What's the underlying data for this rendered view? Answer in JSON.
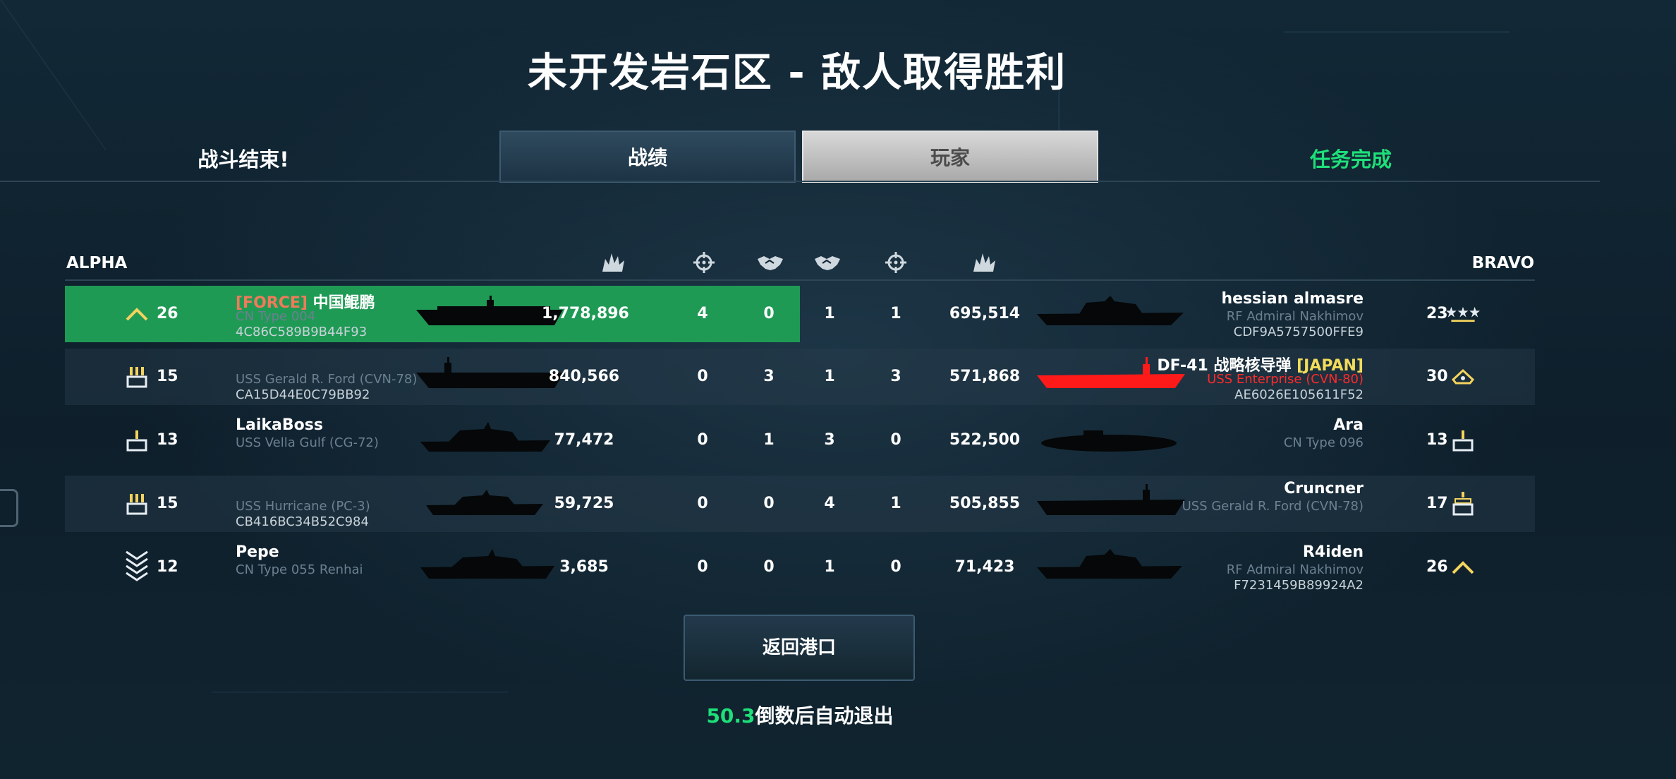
{
  "title": "未开发岩石区 - 敌人取得胜利",
  "header": {
    "battle_over": "战斗结束!",
    "tabs": [
      {
        "label": "战绩"
      },
      {
        "label": "玩家",
        "selected": true
      }
    ],
    "mission_status": "任务完成"
  },
  "teams": {
    "left": "ALPHA",
    "right": "BRAVO"
  },
  "column_icons": [
    "explosion-icon",
    "crosshair-icon",
    "handshake-icon",
    "handshake-icon",
    "crosshair-icon",
    "explosion-icon"
  ],
  "rows": [
    {
      "left": {
        "rank_icon": "chevron-icon",
        "level": "26",
        "tag": "[FORCE]",
        "name": "中国鲲鹏",
        "ship": "CN Type 004",
        "id": "4C86C589B9B44F93",
        "score": "1,778,896",
        "kills": "4",
        "assists": "0",
        "highlight": true
      },
      "right": {
        "rank_icon": "three-stars-icon",
        "level": "23",
        "name": "hessian almasre",
        "ship": "RF Admiral Nakhimov",
        "id": "CDF9A5757500FFE9",
        "score": "695,514",
        "kills": "1",
        "assists": "1"
      }
    },
    {
      "left": {
        "rank_icon": "triple-bars-icon",
        "level": "15",
        "tag": "",
        "name": "",
        "ship": "USS Gerald R. Ford (CVN-78)",
        "id": "CA15D44E0C79BB92",
        "score": "840,566",
        "kills": "0",
        "assists": "3"
      },
      "right": {
        "rank_icon": "cap-icon",
        "level": "30",
        "name": "DF-41 战略核导弹",
        "tag": "[JAPAN]",
        "ship": "USS Enterprise (CVN-80)",
        "id": "AE6026E105611F52",
        "score": "571,868",
        "kills": "3",
        "assists": "1",
        "ship_red": true
      }
    },
    {
      "left": {
        "rank_icon": "single-bar-icon",
        "level": "13",
        "tag": "",
        "name": "LaikaBoss",
        "ship": "USS Vella Gulf (CG-72)",
        "id": "",
        "score": "77,472",
        "kills": "0",
        "assists": "1"
      },
      "right": {
        "rank_icon": "single-bar-icon",
        "level": "13",
        "name": "Ara",
        "tag": "",
        "ship": "CN Type 096",
        "id": "",
        "score": "522,500",
        "kills": "0",
        "assists": "3"
      }
    },
    {
      "left": {
        "rank_icon": "triple-bars-icon",
        "level": "15",
        "tag": "",
        "name": "",
        "ship": "USS Hurricane (PC-3)",
        "id": "CB416BC34B52C984",
        "score": "59,725",
        "kills": "0",
        "assists": "0"
      },
      "right": {
        "rank_icon": "bar-badge-icon",
        "level": "17",
        "name": "Cruncner",
        "tag": "",
        "ship": "USS Gerald R. Ford (CVN-78)",
        "id": "",
        "score": "505,855",
        "kills": "1",
        "assists": "4"
      }
    },
    {
      "left": {
        "rank_icon": "stacked-chevrons-icon",
        "level": "12",
        "tag": "",
        "name": "Pepe",
        "ship": "CN Type 055 Renhai",
        "id": "",
        "score": "3,685",
        "kills": "0",
        "assists": "0"
      },
      "right": {
        "rank_icon": "chevron-icon",
        "level": "26",
        "name": "R4iden",
        "tag": "",
        "ship": "RF Admiral Nakhimov",
        "id": "F7231459B89924A2",
        "score": "71,423",
        "kills": "0",
        "assists": "1"
      }
    }
  ],
  "return_button": "返回港口",
  "countdown": {
    "seconds": "50.3",
    "text": "倒数后自动退出"
  },
  "colors": {
    "highlight": "#1f9a55",
    "accent_green": "#1ee07a",
    "force_tag": "#f07a5a",
    "japan_tag": "#f2dc5a",
    "enemy_red": "#ff2a2a"
  }
}
